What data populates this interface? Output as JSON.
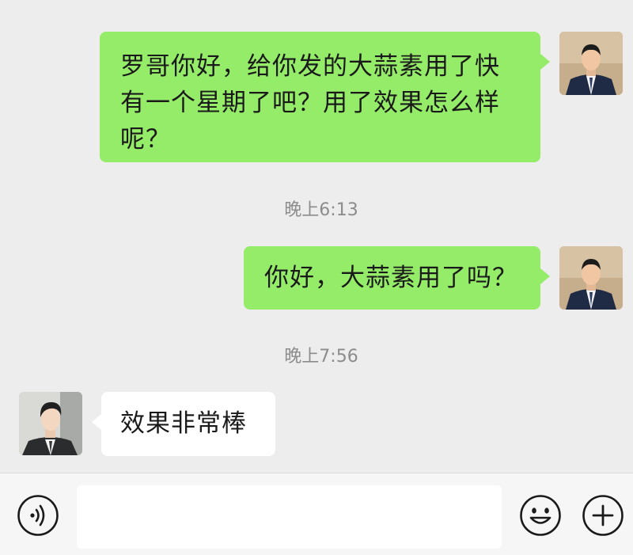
{
  "messages": [
    {
      "direction": "out",
      "text": "罗哥你好，给你发的大蒜素用了快有一个星期了吧？用了效果怎么样呢？"
    },
    {
      "direction": "out",
      "text": "你好，大蒜素用了吗？"
    },
    {
      "direction": "in",
      "text": "效果非常棒"
    }
  ],
  "timestamps": [
    "晚上6:13",
    "晚上7:56"
  ],
  "input_bar": {
    "message_value": "",
    "voice_icon": "voice-icon",
    "emoji_icon": "emoji-icon",
    "more_icon": "plus-icon"
  },
  "colors": {
    "background": "#ededed",
    "sent_bubble": "#95ec69",
    "received_bubble": "#ffffff",
    "timestamp_text": "#8c8c8c"
  }
}
